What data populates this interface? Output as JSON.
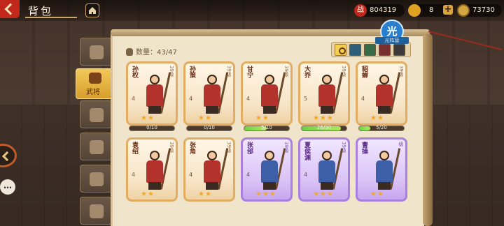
{
  "header": {
    "title": "背包"
  },
  "resources": {
    "power": {
      "icon": "战",
      "value": "804319"
    },
    "scroll": {
      "value": "8",
      "plus": "+"
    },
    "coin": {
      "value": "73730"
    }
  },
  "side_tabs": [
    {
      "name": "bag-tab",
      "label": ""
    },
    {
      "name": "general-tab",
      "label": "武将",
      "active": true
    },
    {
      "name": "weapon-tab",
      "label": ""
    },
    {
      "name": "armor-tab",
      "label": ""
    },
    {
      "name": "horse-tab",
      "label": ""
    },
    {
      "name": "misc-tab",
      "label": ""
    }
  ],
  "inventory": {
    "count_label": "数量：43/47"
  },
  "camp": {
    "badge": "光",
    "tag": "光阵营"
  },
  "cards": [
    {
      "name": "孙权",
      "level": "39级",
      "stars_num": "4",
      "rarity": "orange",
      "star_count": 2,
      "progress": "0/10",
      "fill": 0.0
    },
    {
      "name": "孙策",
      "level": "39级",
      "stars_num": "4",
      "rarity": "orange",
      "star_count": 2,
      "progress": "0/10",
      "fill": 0.0
    },
    {
      "name": "甘宁",
      "level": "39级",
      "stars_num": "4",
      "rarity": "orange",
      "star_count": 2,
      "progress": "5/10",
      "fill": 0.5
    },
    {
      "name": "大乔",
      "level": "39级",
      "stars_num": "5",
      "rarity": "orange",
      "star_count": 3,
      "progress": "26/30",
      "fill": 0.87
    },
    {
      "name": "貂蝉",
      "level": "39级",
      "stars_num": "4",
      "rarity": "orange",
      "star_count": 2,
      "progress": "5/20",
      "fill": 0.25
    },
    {
      "name": "袁绍",
      "level": "39级",
      "stars_num": "4",
      "rarity": "orange",
      "star_count": 2,
      "progress": "",
      "fill": null
    },
    {
      "name": "张角",
      "level": "39级",
      "stars_num": "4",
      "rarity": "orange",
      "star_count": 2,
      "progress": "",
      "fill": null
    },
    {
      "name": "张郃",
      "level": "39级",
      "stars_num": "4",
      "rarity": "purple",
      "star_count": 3,
      "progress": "",
      "fill": null
    },
    {
      "name": "夏侯渊",
      "level": "39级",
      "stars_num": "4",
      "rarity": "purple",
      "star_count": 3,
      "progress": "",
      "fill": null
    },
    {
      "name": "曹操",
      "level": "级",
      "stars_num": "",
      "rarity": "purple",
      "star_count": 2,
      "progress": "",
      "fill": null
    }
  ]
}
